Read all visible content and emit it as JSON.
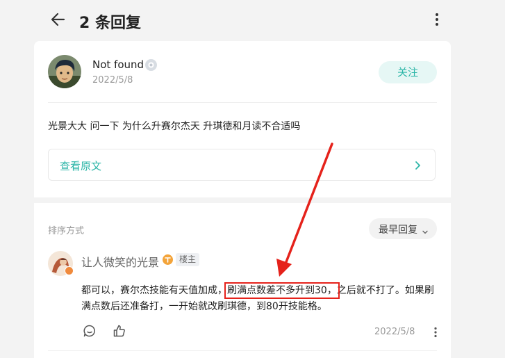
{
  "header": {
    "title": "2 条回复"
  },
  "post": {
    "author": "Not found",
    "date": "2022/5/8",
    "follow_label": "关注",
    "content": "光景大大 问一下 为什么升赛尔杰天 升琪德和月读不合适吗",
    "view_original_label": "查看原文"
  },
  "replies": {
    "sort_label": "排序方式",
    "sort_value": "最早回复",
    "items": [
      {
        "author": "让人微笑的光景",
        "tag": "楼主",
        "text_before": "都可以，赛尔杰技能有天值加成，",
        "text_highlight": "刷满点数差不多升到30，",
        "text_after": "之后就不打了。如果刷满点数后还准备打，一开始就改刷琪德，到80开技能格。",
        "date": "2022/5/8"
      }
    ]
  },
  "colors": {
    "accent": "#2bb5a7",
    "annotation": "#e5221b"
  }
}
